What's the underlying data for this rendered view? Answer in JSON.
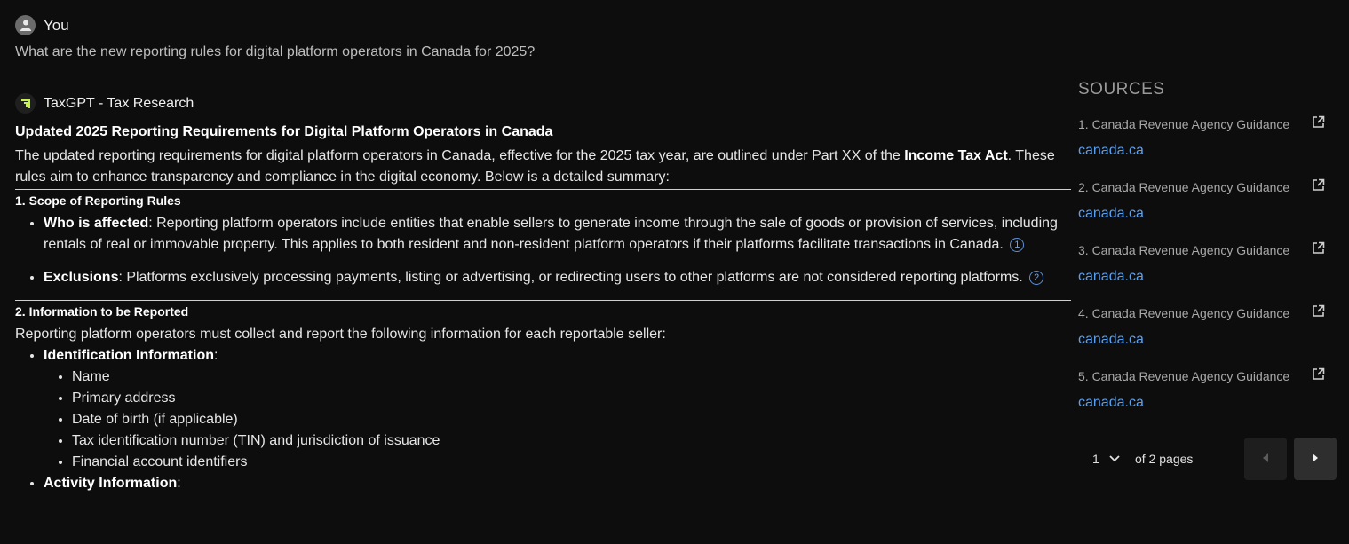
{
  "user": {
    "name": "You",
    "question": "What are the new reporting rules for digital platform operators in Canada for 2025?"
  },
  "bot": {
    "name": "TaxGPT - Tax Research"
  },
  "answer": {
    "heading": "Updated 2025 Reporting Requirements for Digital Platform Operators in Canada",
    "intro_a": "The updated reporting requirements for digital platform operators in Canada, effective for the 2025 tax year, are outlined under Part XX of the ",
    "intro_bold": "Income Tax Act",
    "intro_b": ". These rules aim to enhance transparency and compliance in the digital economy. Below is a detailed summary:",
    "section1": {
      "title": "1. Scope of Reporting Rules",
      "item1_label": "Who is affected",
      "item1_text": ": Reporting platform operators include entities that enable sellers to generate income through the sale of goods or provision of services, including rentals of real or immovable property. This applies to both resident and non-resident platform operators if their platforms facilitate transactions in Canada.",
      "item1_cite": "1",
      "item2_label": "Exclusions",
      "item2_text": ": Platforms exclusively processing payments, listing or advertising, or redirecting users to other platforms are not considered reporting platforms.",
      "item2_cite": "2"
    },
    "section2": {
      "title": "2. Information to be Reported",
      "intro": "Reporting platform operators must collect and report the following information for each reportable seller:",
      "id_label": "Identification Information",
      "id_items": [
        "Name",
        "Primary address",
        "Date of birth (if applicable)",
        "Tax identification number (TIN) and jurisdiction of issuance",
        "Financial account identifiers"
      ],
      "activity_label": "Activity Information"
    }
  },
  "sources": {
    "title": "SOURCES",
    "items": [
      {
        "title": "1. Canada Revenue Agency Guidance",
        "link": "canada.ca"
      },
      {
        "title": "2. Canada Revenue Agency Guidance",
        "link": "canada.ca"
      },
      {
        "title": "3. Canada Revenue Agency Guidance",
        "link": "canada.ca"
      },
      {
        "title": "4. Canada Revenue Agency Guidance",
        "link": "canada.ca"
      },
      {
        "title": "5. Canada Revenue Agency Guidance",
        "link": "canada.ca"
      }
    ]
  },
  "pager": {
    "current": "1",
    "of_text": "of 2 pages"
  },
  "icons": {
    "user": "user-icon",
    "bot": "taxgpt-logo-icon",
    "external": "external-link-icon",
    "prev": "caret-left-icon",
    "next": "caret-right-icon",
    "dropdown": "chevron-down-icon"
  },
  "colors": {
    "link": "#5aa0f0",
    "background": "#0d0d0d",
    "logo_accent": "#c6f24e"
  }
}
